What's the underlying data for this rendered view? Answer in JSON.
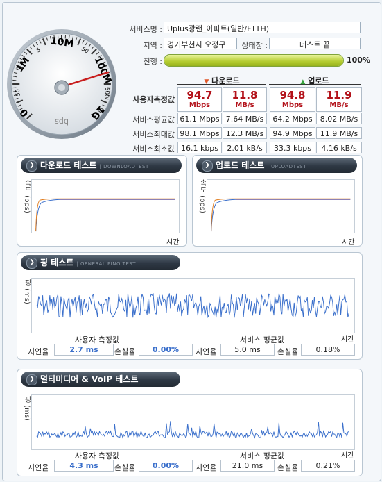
{
  "info": {
    "service_label": "서비스명 :",
    "service_value": "Uplus광랜_아파트(일반/FTTH)",
    "region_label": "지역 :",
    "region_value": "경기부천시 오정구",
    "status_label": "상태창 :",
    "status_value": "테스트 끝",
    "progress_label": "진행 :",
    "progress_value": "100%",
    "progress_fraction": 1.0
  },
  "gauge": {
    "labels": [
      "0",
      "1M",
      "10M",
      "100M",
      "1G",
      "bps",
      "bps"
    ],
    "minor_labels": [
      "5",
      "50",
      "500"
    ]
  },
  "speed_table": {
    "download_header": "다운로드",
    "upload_header": "업로드",
    "rows": [
      {
        "label": "사용자측정값",
        "cells": [
          {
            "v": "94.7",
            "u": "Mbps"
          },
          {
            "v": "11.8",
            "u": "MB/s"
          },
          {
            "v": "94.8",
            "u": "Mbps"
          },
          {
            "v": "11.9",
            "u": "MB/s"
          }
        ]
      },
      {
        "label": "서비스평균값",
        "cells": [
          "61.1 Mbps",
          "7.64 MB/s",
          "64.2 Mbps",
          "8.02 MB/s"
        ]
      },
      {
        "label": "서비스최대값",
        "cells": [
          "98.1 Mbps",
          "12.3 MB/s",
          "94.9 Mbps",
          "11.9 MB/s"
        ]
      },
      {
        "label": "서비스최소값",
        "cells": [
          "16.1 kbps",
          "2.01 kB/s",
          "33.3 kbps",
          "4.16 kB/s"
        ]
      }
    ]
  },
  "download_test": {
    "title": "다운로드 테스트",
    "sub": "DOWNLOADTEST",
    "ylabel": "속도 (bps)",
    "xlabel": "시간"
  },
  "upload_test": {
    "title": "업로드 테스트",
    "sub": "UPLOADTEST",
    "ylabel": "속도 (bps)",
    "xlabel": "시간"
  },
  "ping_test": {
    "title": "핑 테스트",
    "sub": "GENERAL PING TEST",
    "ylabel": "핑 (ms)",
    "xlabel": "시간",
    "user_title": "사용자 측정값",
    "service_title": "서비스 평균값",
    "latency_label": "지연율",
    "loss_label": "손실율",
    "user_latency": "2.7 ms",
    "user_loss": "0.00%",
    "service_latency": "5.0 ms",
    "service_loss": "0.18%"
  },
  "voip_test": {
    "title": "멀티미디어 & VoIP 테스트",
    "ylabel": "핑 (ms)",
    "xlabel": "시간",
    "user_title": "사용자 측정값",
    "service_title": "서비스 평균값",
    "latency_label": "지연율",
    "loss_label": "손실율",
    "user_latency": "4.3 ms",
    "user_loss": "0.00%",
    "service_latency": "21.0 ms",
    "service_loss": "0.21%"
  },
  "colors": {
    "accent_red": "#b3121a",
    "plot_blue": "#3a6fcb",
    "plot_orange": "#e07a1a",
    "plot_red": "#c0283c",
    "progress_green": "#b3cc2e"
  }
}
